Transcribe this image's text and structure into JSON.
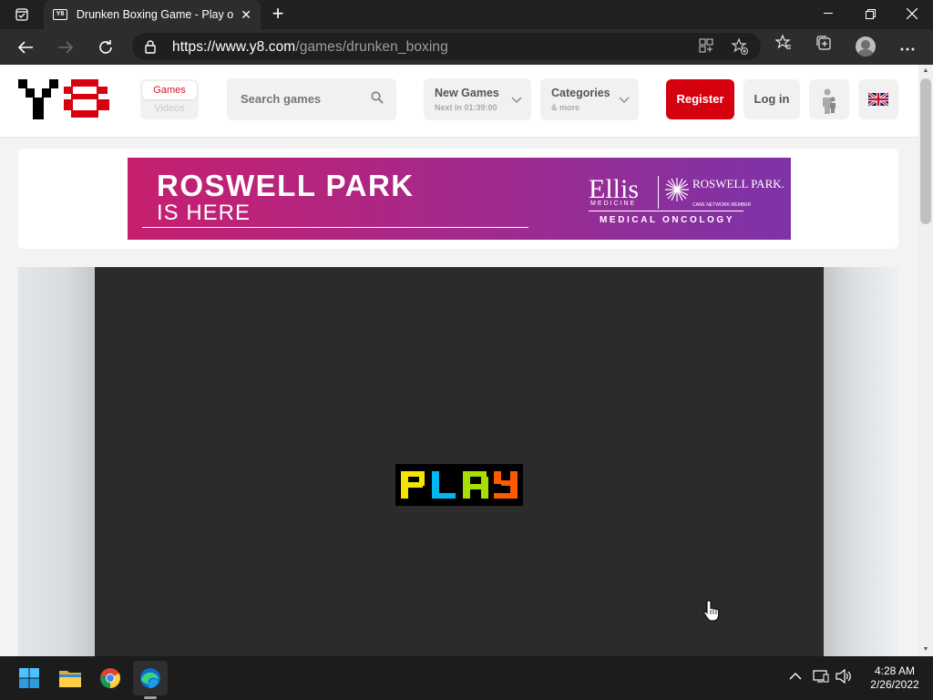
{
  "browser": {
    "tab_title": "Drunken Boxing Game - Play onl",
    "favicon_text": "Y8",
    "url_host": "https://www.y8.com",
    "url_path": "/games/drunken_boxing"
  },
  "header": {
    "toggle": {
      "games": "Games",
      "videos": "Videos"
    },
    "search_placeholder": "Search games",
    "new_games": {
      "title": "New Games",
      "subtitle": "Next in 01:39:00"
    },
    "categories": {
      "title": "Categories",
      "subtitle": "& more"
    },
    "register": "Register",
    "login": "Log in",
    "accent_color": "#d7000f"
  },
  "ad": {
    "headline": "ROSWELL PARK",
    "subline": "IS HERE",
    "brand1": "Ellis",
    "brand1_sub": "MEDICINE",
    "brand2": "ROSWELL PARK.",
    "brand2_sub": "CARE NETWORK MEMBER",
    "tagline": "MEDICAL ONCOLOGY"
  },
  "game": {
    "play_label": "PLAY",
    "play_colors": [
      "#f5e400",
      "#00b7f0",
      "#a6e000",
      "#ff5a00"
    ]
  },
  "taskbar": {
    "time": "4:28 AM",
    "date": "2/26/2022"
  }
}
